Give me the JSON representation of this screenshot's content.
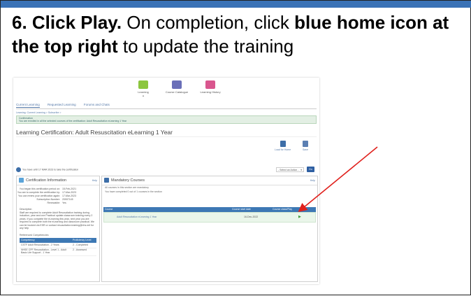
{
  "instruction": {
    "step": "6. Click Play.",
    "text1": " On completion, click ",
    "bold": "blue home icon at the top right",
    "text2": " to update the training"
  },
  "screenshot": {
    "nav_icons": [
      {
        "label": "Learning",
        "color": "#8cc63f"
      },
      {
        "label": "Course Catalogue",
        "color": "#6a6fb8"
      },
      {
        "label": "Learning History",
        "color": "#d9568e"
      }
    ],
    "tabs": [
      "Current Learning",
      "Requested Learning",
      "Forums and Chats"
    ],
    "breadcrumb": "Learning: Current Learning > Subscribe >",
    "confirmation_title": "Confirmation",
    "confirmation_text": "You are enrolled in all the selected courses of the certification: Adult Resuscitation eLearning 1 Year",
    "page_title": "Learning Certification: Adult Resuscitation eLearning 1 Year",
    "actions": [
      {
        "label": "Load for Home",
        "color": "#3d6ea8"
      },
      {
        "label": "Save",
        "color": "#5b7fb3"
      }
    ],
    "renew_text": "You have until 17 MAR 2023 to take the certification",
    "select_action": "- Select an Action -",
    "go_label": "Go",
    "cert_panel": {
      "title": "Certification Information",
      "help": "Help",
      "fields": [
        {
          "k": "You began this certification period on:",
          "v": "15-Feb-2021"
        },
        {
          "k": "You are to complete the certification by:",
          "v": "17-Mar-2023"
        },
        {
          "k": "You can renew your certification again:",
          "v": "17-Mar-2023"
        },
        {
          "k": "Subscription Number:",
          "v": "20907145"
        },
        {
          "k": "Renewable:",
          "v": "Yes"
        }
      ],
      "desc_heading": "Description",
      "desc_text": "Staff are required to complete Adult Resuscitation training during induction, year and one Practical update classroom training every 2 years. If you complete the eLearning this year, next year you are required to complete both the eLearning and classroom practical. We can be booked via ESR or contact resuscitation.training@nhs.net for any help",
      "referenced_heading": "Referenced Competencies",
      "ref_cols": [
        "Competency",
        "Proficiency Level"
      ],
      "ref_rows": [
        {
          "c": "CSTF Adult Resuscitation - 2 Years",
          "l": "2 - Completed"
        },
        {
          "c": "NHSE CPF Resuscitation - Level 1 - Adult Basic Life Support - 1 Year",
          "l": "2 - Assessed"
        }
      ]
    },
    "mand_panel": {
      "title": "Mandatory Courses",
      "help": "Help",
      "line1": "All courses in this section are mandatory",
      "line2": "You have completed 0 out of 1 courses in the section",
      "cols": [
        "Course",
        "Course start date",
        "Course class/Play"
      ],
      "row_course": "Adult Resuscitation eLearning 1 Year",
      "row_date": "16-Dec-2022",
      "play_icon": "play-icon"
    },
    "arrow_color": "#e0201c"
  }
}
